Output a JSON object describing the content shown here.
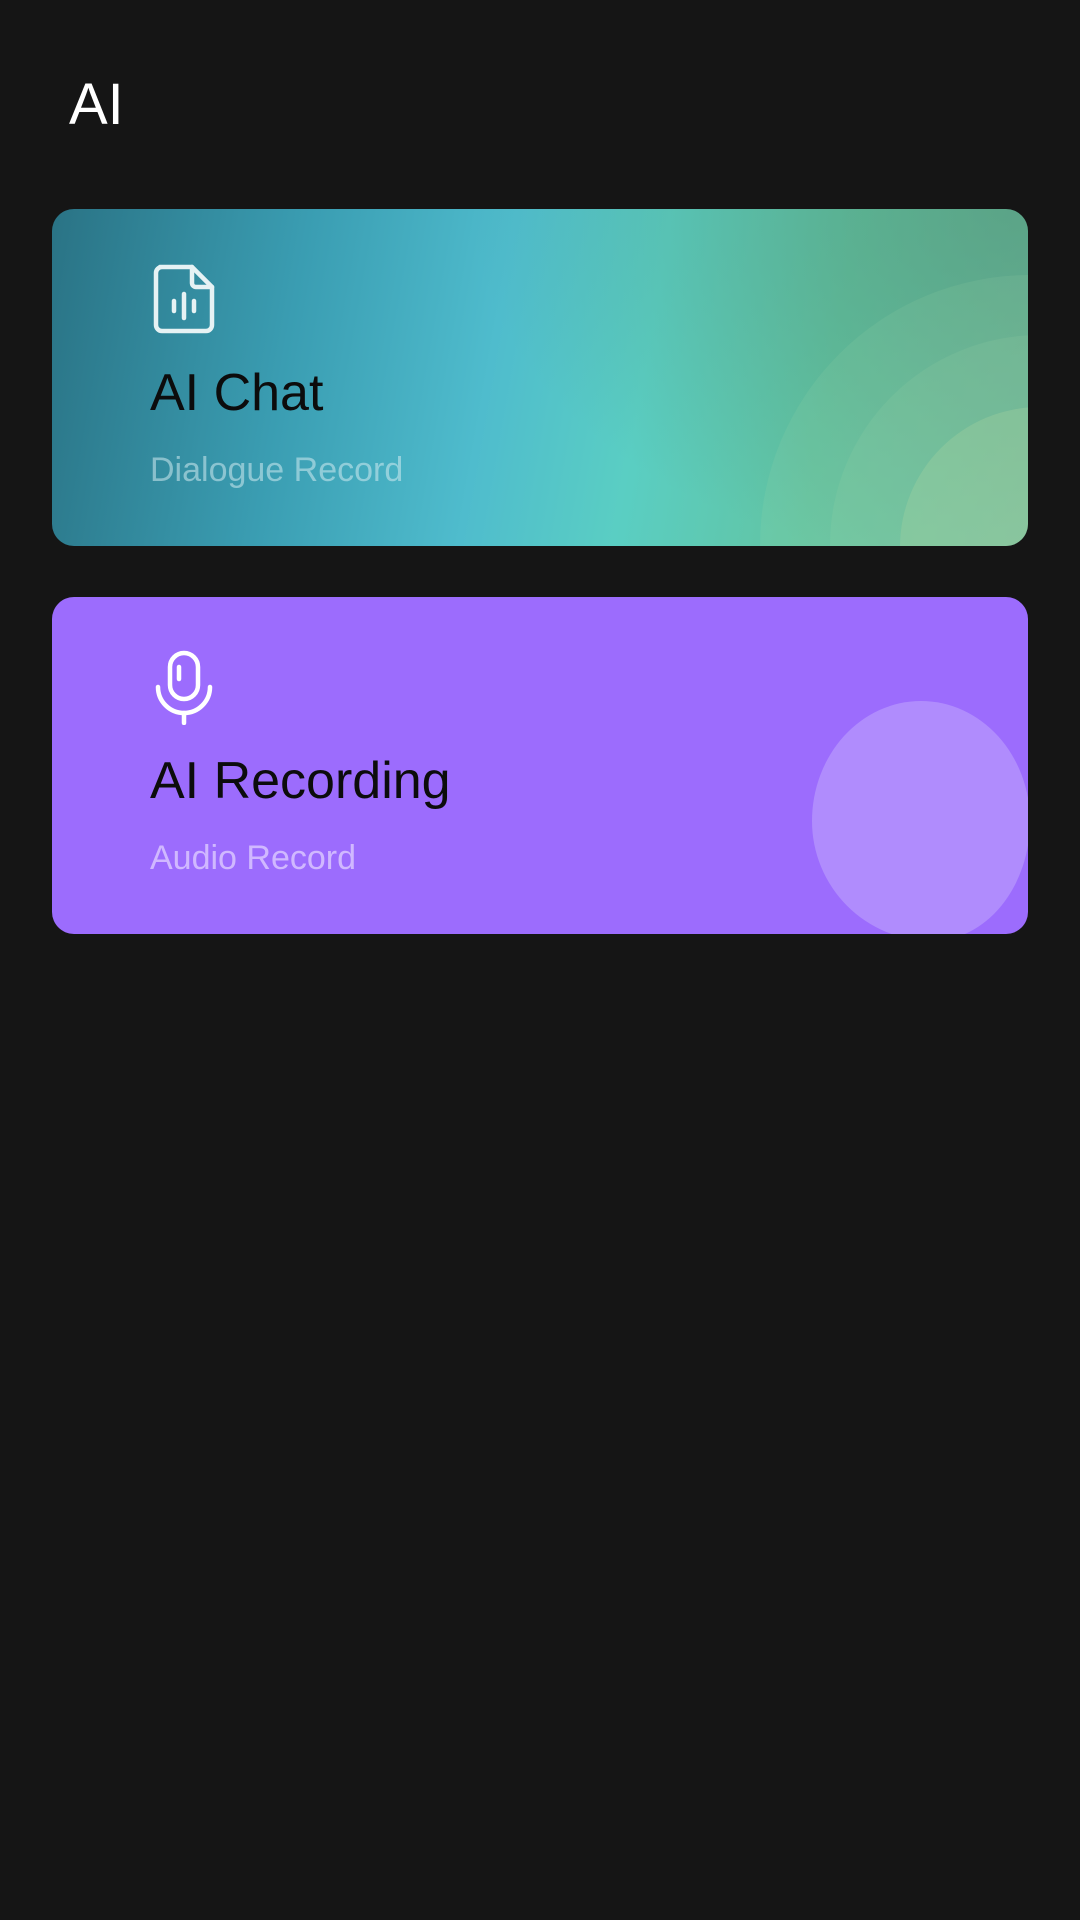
{
  "header": {
    "title": "AI"
  },
  "cards": [
    {
      "id": "ai-chat",
      "title": "AI Chat",
      "subtitle": "Dialogue Record",
      "icon": "audio-file-icon",
      "accent": "#4fbccd"
    },
    {
      "id": "ai-recording",
      "title": "AI Recording",
      "subtitle": "Audio Record",
      "icon": "microphone-icon",
      "accent": "#9c6cfd"
    }
  ],
  "colors": {
    "background": "#151515",
    "title_text": "#ffffff",
    "card_title_text": "#0c0c0c"
  }
}
